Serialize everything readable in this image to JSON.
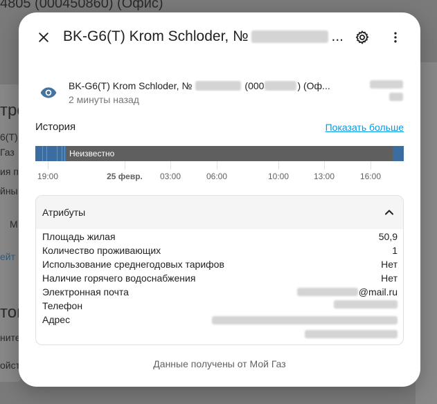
{
  "background": {
    "title": "4805 (000450860) (Офис)",
    "snippets": [
      "тро",
      "6(Т)",
      "Газ",
      "ия пр",
      "йны",
      "М",
      "ейт",
      "том",
      "ните",
      "ойст",
      "й"
    ]
  },
  "dialog": {
    "title_prefix": "BK-G6(T) Krom Schloder, №",
    "title_suffix": "...",
    "close_icon": "close-icon",
    "settings_icon": "gear-icon",
    "more_icon": "more-vert-icon"
  },
  "entity": {
    "icon": "eye-icon",
    "name_prefix": "BK-G6(T) Krom Schloder, №",
    "name_mid": "(000",
    "name_suffix": ") (Оф...",
    "last_changed": "2 минуты назад"
  },
  "history": {
    "label": "История",
    "show_more": "Показать больше",
    "state_label": "Неизвестно",
    "ticks": [
      {
        "label": "19:00",
        "bold": false
      },
      {
        "label": "25 февр.",
        "bold": true
      },
      {
        "label": "03:00",
        "bold": false
      },
      {
        "label": "06:00",
        "bold": false
      },
      {
        "label": "10:00",
        "bold": false
      },
      {
        "label": "13:00",
        "bold": false
      },
      {
        "label": "16:00",
        "bold": false
      }
    ]
  },
  "attributes": {
    "header": "Атрибуты",
    "chevron_icon": "chevron-up-icon",
    "items": [
      {
        "key": "Площадь жилая",
        "value": "50,9"
      },
      {
        "key": "Количество проживающих",
        "value": "1"
      },
      {
        "key": "Использование среднегодовых тарифов",
        "value": "Нет"
      },
      {
        "key": "Наличие горячего водоснабжения",
        "value": "Нет"
      },
      {
        "key": "Электронная почта",
        "value": "@mail.ru"
      },
      {
        "key": "Телефон",
        "value": ""
      },
      {
        "key": "Адрес",
        "value": ""
      }
    ]
  },
  "footer": {
    "note": "Данные получены от Мой Газ"
  },
  "colors": {
    "accent_link": "#039be5",
    "timeline_unknown": "#5f5f5f",
    "timeline_state": "#3b6da0"
  }
}
